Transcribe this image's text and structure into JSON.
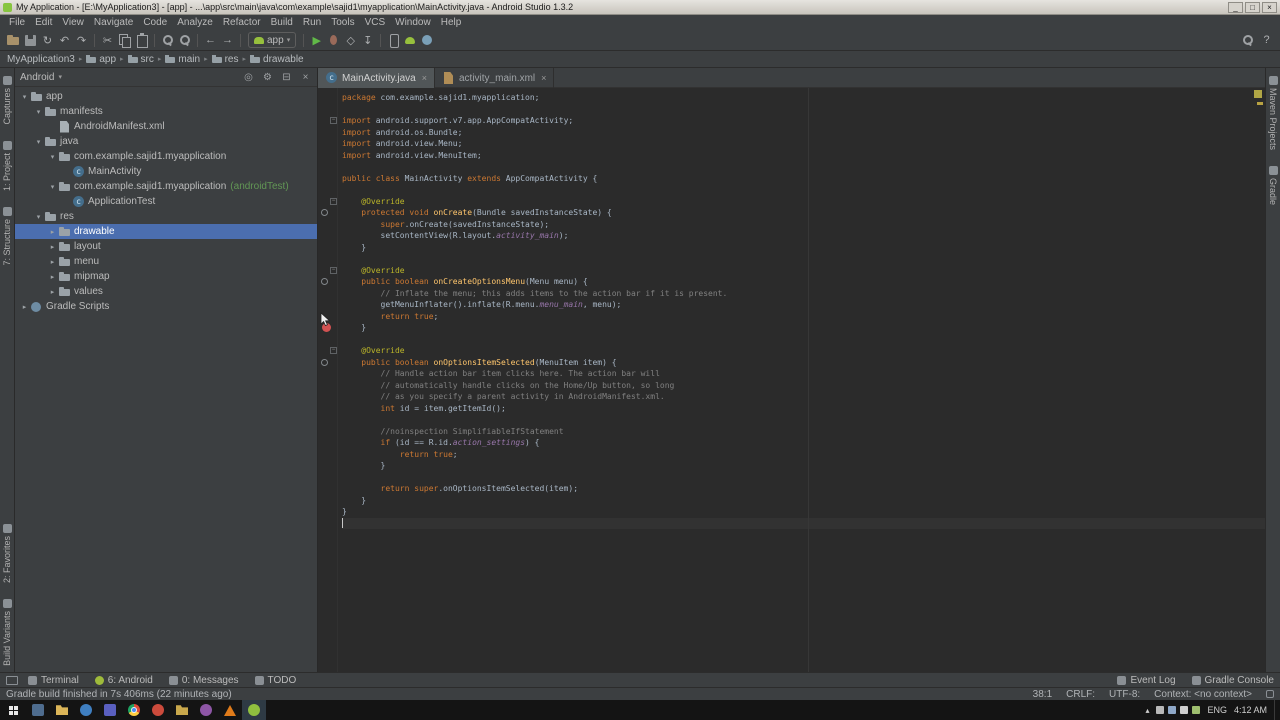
{
  "window": {
    "title": "My Application - [E:\\MyApplication3] - [app] - ...\\app\\src\\main\\java\\com\\example\\sajid1\\myapplication\\MainActivity.java - Android Studio 1.3.2"
  },
  "menu_bar": [
    "File",
    "Edit",
    "View",
    "Navigate",
    "Code",
    "Analyze",
    "Refactor",
    "Build",
    "Run",
    "Tools",
    "VCS",
    "Window",
    "Help"
  ],
  "toolbar": {
    "run_config": {
      "label": "app"
    },
    "groups": [
      {
        "items": [
          [
            "open-icon",
            "s-folder"
          ],
          [
            "save-all-icon",
            "s-floppy"
          ],
          [
            "sync-icon",
            "g:↻"
          ],
          [
            "undo-icon",
            "g:↶"
          ],
          [
            "redo-icon",
            "g:↷"
          ]
        ]
      },
      {
        "items": [
          [
            "cut-icon",
            "g:✂"
          ],
          [
            "copy-icon",
            "s-copy"
          ],
          [
            "paste-icon",
            "s-paste"
          ]
        ]
      },
      {
        "items": [
          [
            "find-icon",
            "s-mag"
          ],
          [
            "replace-icon",
            "s-mag"
          ]
        ]
      },
      {
        "items": [
          [
            "back-icon",
            "g:←"
          ],
          [
            "forward-icon",
            "g:→"
          ]
        ]
      },
      {
        "run_config": true,
        "items": []
      },
      {
        "items": [
          [
            "run-icon",
            "g:▶:#61b948"
          ],
          [
            "debug-icon",
            "s-bug"
          ],
          [
            "run-coverage-icon",
            "g:◇"
          ],
          [
            "attach-debugger-icon",
            "g:↧"
          ]
        ]
      },
      {
        "items": [
          [
            "avd-manager-icon",
            "s-phone"
          ],
          [
            "sdk-manager-icon",
            "s-android"
          ],
          [
            "gradle-sync-icon",
            "s-gradle"
          ]
        ]
      }
    ],
    "right_items": [
      [
        "search-everywhere-icon",
        "s-mag"
      ],
      [
        "help-icon",
        "g:?"
      ]
    ]
  },
  "breadcrumbs": [
    "MyApplication3",
    "app",
    "src",
    "main",
    "res",
    "drawable"
  ],
  "project_panel": {
    "view_selector": "Android",
    "header_icons": [
      [
        "scroll-from-source-icon",
        "◎"
      ],
      [
        "settings-gear-icon",
        "⚙"
      ],
      [
        "collapse-all-icon",
        "⊟"
      ],
      [
        "hide-panel-icon",
        "×"
      ]
    ],
    "tree": [
      {
        "l": "app",
        "d": 0,
        "a": "e",
        "i": "folder"
      },
      {
        "l": "manifests",
        "d": 1,
        "a": "e",
        "i": "folder"
      },
      {
        "l": "AndroidManifest.xml",
        "d": 2,
        "a": "",
        "i": "file"
      },
      {
        "l": "java",
        "d": 1,
        "a": "e",
        "i": "folder"
      },
      {
        "l": "com.example.sajid1.myapplication",
        "d": 2,
        "a": "e",
        "i": "package"
      },
      {
        "l": "MainActivity",
        "d": 3,
        "a": "",
        "i": "class"
      },
      {
        "l": "com.example.sajid1.myapplication",
        "suf": "(androidTest)",
        "d": 2,
        "a": "e",
        "i": "package"
      },
      {
        "l": "ApplicationTest",
        "d": 3,
        "a": "",
        "i": "class"
      },
      {
        "l": "res",
        "d": 1,
        "a": "e",
        "i": "folder"
      },
      {
        "l": "drawable",
        "d": 2,
        "a": "c",
        "i": "folder",
        "sel": true
      },
      {
        "l": "layout",
        "d": 2,
        "a": "c",
        "i": "folder"
      },
      {
        "l": "menu",
        "d": 2,
        "a": "c",
        "i": "folder"
      },
      {
        "l": "mipmap",
        "d": 2,
        "a": "c",
        "i": "folder"
      },
      {
        "l": "values",
        "d": 2,
        "a": "c",
        "i": "folder"
      },
      {
        "l": "Gradle Scripts",
        "d": 0,
        "a": "c",
        "i": "gradle"
      }
    ]
  },
  "editor": {
    "tabs": [
      {
        "label": "MainActivity.java",
        "icon": "class",
        "active": true
      },
      {
        "label": "activity_main.xml",
        "icon": "xml",
        "active": false
      }
    ],
    "code": {
      "caret_line": 38,
      "breakpoint_line": 21,
      "override_lines": [
        11,
        17,
        24
      ],
      "fold_lines": [
        3,
        10,
        16,
        23
      ],
      "lines": [
        [
          [
            "k",
            "package"
          ],
          [
            "p",
            " com.example.sajid1.myapplication;"
          ]
        ],
        [],
        [
          [
            "k",
            "import"
          ],
          [
            "p",
            " android.support.v7.app.AppCompatActivity;"
          ]
        ],
        [
          [
            "k",
            "import"
          ],
          [
            "p",
            " android.os.Bundle;"
          ]
        ],
        [
          [
            "k",
            "import"
          ],
          [
            "p",
            " android.view.Menu;"
          ]
        ],
        [
          [
            "k",
            "import"
          ],
          [
            "p",
            " android.view.MenuItem;"
          ]
        ],
        [],
        [
          [
            "k",
            "public class"
          ],
          [
            "p",
            " MainActivity "
          ],
          [
            "k",
            "extends"
          ],
          [
            "p",
            " AppCompatActivity {"
          ]
        ],
        [],
        [
          [
            "p",
            "    "
          ],
          [
            "a",
            "@Override"
          ]
        ],
        [
          [
            "p",
            "    "
          ],
          [
            "k",
            "protected void"
          ],
          [
            "p",
            " "
          ],
          [
            "m",
            "onCreate"
          ],
          [
            "p",
            "(Bundle savedInstanceState) {"
          ]
        ],
        [
          [
            "p",
            "        "
          ],
          [
            "k",
            "super"
          ],
          [
            "p",
            ".onCreate(savedInstanceState);"
          ]
        ],
        [
          [
            "p",
            "        setContentView(R.layout."
          ],
          [
            "f",
            "activity_main"
          ],
          [
            "p",
            ");"
          ]
        ],
        [
          [
            "p",
            "    }"
          ]
        ],
        [],
        [
          [
            "p",
            "    "
          ],
          [
            "a",
            "@Override"
          ]
        ],
        [
          [
            "p",
            "    "
          ],
          [
            "k",
            "public boolean"
          ],
          [
            "p",
            " "
          ],
          [
            "m",
            "onCreateOptionsMenu"
          ],
          [
            "p",
            "(Menu menu) {"
          ]
        ],
        [
          [
            "p",
            "        "
          ],
          [
            "c",
            "// Inflate the menu; this adds items to the action bar if it is present."
          ]
        ],
        [
          [
            "p",
            "        getMenuInflater().inflate(R.menu."
          ],
          [
            "f",
            "menu_main"
          ],
          [
            "p",
            ", menu);"
          ]
        ],
        [
          [
            "p",
            "        "
          ],
          [
            "k",
            "return true"
          ],
          [
            "p",
            ";"
          ]
        ],
        [
          [
            "p",
            "    }"
          ]
        ],
        [],
        [
          [
            "p",
            "    "
          ],
          [
            "a",
            "@Override"
          ]
        ],
        [
          [
            "p",
            "    "
          ],
          [
            "k",
            "public boolean"
          ],
          [
            "p",
            " "
          ],
          [
            "m",
            "onOptionsItemSelected"
          ],
          [
            "p",
            "(MenuItem item) {"
          ]
        ],
        [
          [
            "p",
            "        "
          ],
          [
            "c",
            "// Handle action bar item clicks here. The action bar will"
          ]
        ],
        [
          [
            "p",
            "        "
          ],
          [
            "c",
            "// automatically handle clicks on the Home/Up button, so long"
          ]
        ],
        [
          [
            "p",
            "        "
          ],
          [
            "c",
            "// as you specify a parent activity in AndroidManifest.xml."
          ]
        ],
        [
          [
            "p",
            "        "
          ],
          [
            "k",
            "int"
          ],
          [
            "p",
            " id = item.getItemId();"
          ]
        ],
        [],
        [
          [
            "p",
            "        "
          ],
          [
            "c",
            "//noinspection SimplifiableIfStatement"
          ]
        ],
        [
          [
            "p",
            "        "
          ],
          [
            "k",
            "if"
          ],
          [
            "p",
            " (id == R.id."
          ],
          [
            "f",
            "action_settings"
          ],
          [
            "p",
            ") {"
          ]
        ],
        [
          [
            "p",
            "            "
          ],
          [
            "k",
            "return true"
          ],
          [
            "p",
            ";"
          ]
        ],
        [
          [
            "p",
            "        }"
          ]
        ],
        [],
        [
          [
            "p",
            "        "
          ],
          [
            "k",
            "return super"
          ],
          [
            "p",
            ".onOptionsItemSelected(item);"
          ]
        ],
        [
          [
            "p",
            "    }"
          ]
        ],
        [
          [
            "p",
            "}"
          ]
        ],
        []
      ]
    }
  },
  "tool_stripes": {
    "left_top": [
      "Captures",
      "1: Project",
      "7: Structure"
    ],
    "left_bottom": [
      "2: Favorites",
      "Build Variants"
    ],
    "right_top": [
      "Maven Projects",
      "Gradle"
    ]
  },
  "bottom_bar": {
    "left": [
      {
        "label": "Terminal",
        "icon": "terminal"
      },
      {
        "label": "6: Android",
        "icon": "android"
      },
      {
        "label": "0: Messages",
        "icon": "messages"
      },
      {
        "label": "TODO",
        "icon": "todo"
      }
    ],
    "right": [
      {
        "label": "Event Log",
        "icon": "event-log"
      },
      {
        "label": "Gradle Console",
        "icon": "gradle-console"
      }
    ]
  },
  "status_bar": {
    "message": "Gradle build finished in 7s 406ms (22 minutes ago)",
    "caret_position": "38:1",
    "line_separator": "CRLF:",
    "encoding": "UTF-8:",
    "context": "Context: <no context>"
  },
  "taskbar": {
    "language": "ENG",
    "time": "4:12 AM",
    "apps": [
      {
        "name": "taskbar-app-1",
        "style": "sq",
        "color": "#4f6d8f"
      },
      {
        "name": "file-explorer",
        "style": "folder",
        "color": "#dcb659"
      },
      {
        "name": "taskbar-app-2",
        "style": "circle",
        "color": "#3f7fc1"
      },
      {
        "name": "media-player",
        "style": "sq",
        "color": "#5a5fbf"
      },
      {
        "name": "chrome",
        "style": "chrome",
        "color": ""
      },
      {
        "name": "taskbar-app-3",
        "style": "circle",
        "color": "#cc4b3c"
      },
      {
        "name": "taskbar-folder-2",
        "style": "folder",
        "color": "#c9a84c"
      },
      {
        "name": "photo-viewer",
        "style": "circle",
        "color": "#8e56a6"
      },
      {
        "name": "vlc",
        "style": "cone",
        "color": "#e07b1a"
      },
      {
        "name": "android-studio",
        "style": "android",
        "color": "#8fbf3f",
        "active": true
      }
    ],
    "tray_colors": [
      "#b8b8b8",
      "#8fa8c8",
      "#cfcfcf",
      "#9fbf6f"
    ]
  }
}
